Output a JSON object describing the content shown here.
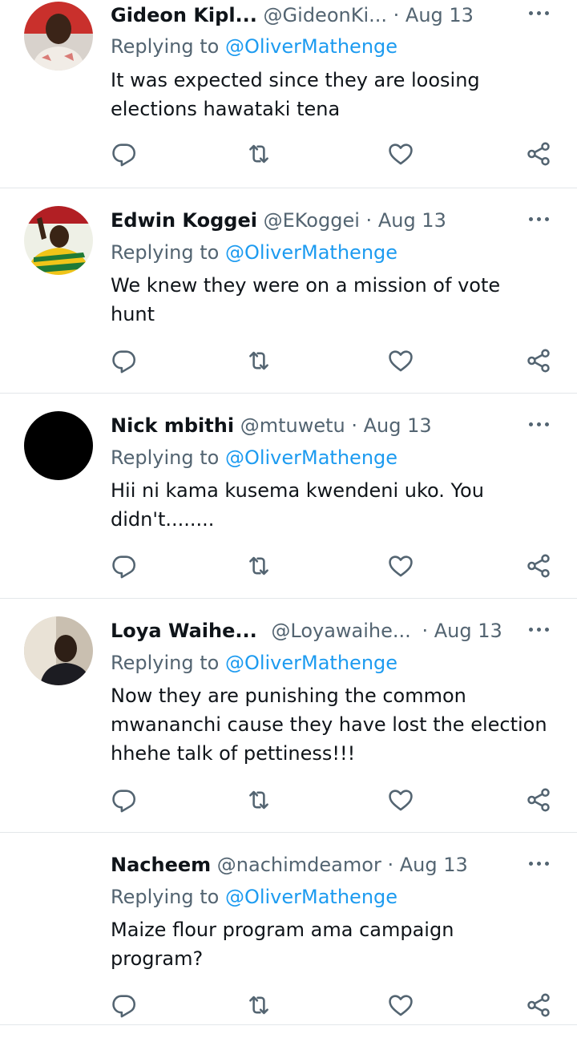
{
  "colors": {
    "text_primary": "#0f1419",
    "text_secondary": "#536471",
    "mention": "#1d9bf0",
    "divider": "#e3e7ea"
  },
  "action_icons": [
    "reply-icon",
    "retweet-icon",
    "like-icon",
    "share-icon"
  ],
  "tweets": [
    {
      "name": "Gideon Kipl...",
      "handle": "@GideonKi...",
      "sep": "·",
      "date": "Aug 13",
      "replying_prefix": "Replying to",
      "replying_to": "@OliverMathenge",
      "text": "It was expected since they are loosing elections hawataki tena"
    },
    {
      "name": "Edwin Koggei",
      "handle": "@EKoggei",
      "sep": "·",
      "date": "Aug 13",
      "replying_prefix": "Replying to",
      "replying_to": "@OliverMathenge",
      "text": "We knew they were on a mission of vote hunt"
    },
    {
      "name": "Nick mbithi",
      "handle": "@mtuwetu",
      "sep": "·",
      "date": "Aug 13",
      "replying_prefix": "Replying to",
      "replying_to": "@OliverMathenge",
      "text": "Hii ni kama kusema kwendeni uko. You didn't........"
    },
    {
      "name": "Loya Waihe...",
      "handle": "@Loyawaihe...",
      "sep": "·",
      "date": "Aug 13",
      "replying_prefix": "Replying to",
      "replying_to": "@OliverMathenge",
      "text": "Now they are punishing the common mwananchi cause they have lost the election hhehe talk of pettiness!!!"
    },
    {
      "name": "Nacheem",
      "handle": "@nachimdeamor",
      "sep": "·",
      "date": "Aug 13",
      "replying_prefix": "Replying to",
      "replying_to": "@OliverMathenge",
      "text": "Maize flour program ama campaign program?"
    }
  ]
}
